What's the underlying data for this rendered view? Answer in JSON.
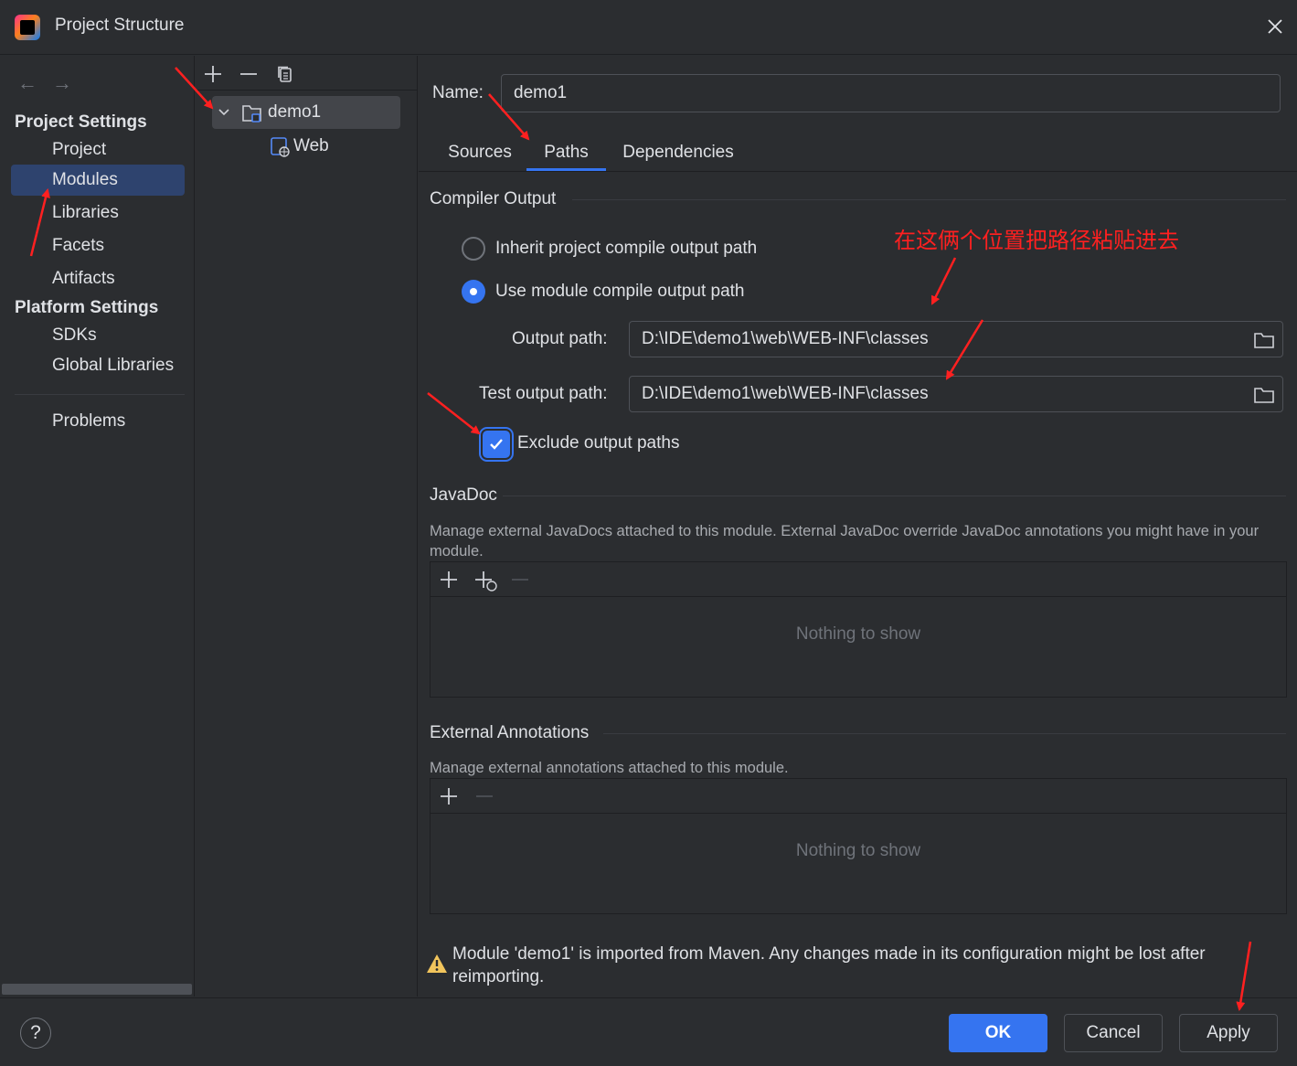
{
  "window": {
    "title": "Project Structure"
  },
  "nav": {
    "back": "←",
    "forward": "→",
    "project_settings_header": "Project Settings",
    "platform_settings_header": "Platform Settings",
    "items": [
      {
        "label": "Project"
      },
      {
        "label": "Modules"
      },
      {
        "label": "Libraries"
      },
      {
        "label": "Facets"
      },
      {
        "label": "Artifacts"
      },
      {
        "label": "SDKs"
      },
      {
        "label": "Global Libraries"
      },
      {
        "label": "Problems"
      }
    ],
    "selected": "Modules"
  },
  "tree": {
    "toolbar": [
      "add-icon",
      "remove-icon",
      "copy-icon"
    ],
    "nodes": [
      {
        "label": "demo1",
        "icon": "module-folder-icon",
        "expanded": true,
        "selected": true
      },
      {
        "label": "Web",
        "icon": "web-facet-icon"
      }
    ]
  },
  "module": {
    "name_label": "Name:",
    "name_value": "demo1",
    "tabs": [
      "Sources",
      "Paths",
      "Dependencies"
    ],
    "active_tab": "Paths",
    "compiler_output": {
      "title": "Compiler Output",
      "inherit_label": "Inherit project compile output path",
      "use_module_label": "Use module compile output path",
      "selected": "use_module",
      "output_path_label": "Output path:",
      "output_path_value": "D:\\IDE\\demo1\\web\\WEB-INF\\classes",
      "test_output_path_label": "Test output path:",
      "test_output_path_value": "D:\\IDE\\demo1\\web\\WEB-INF\\classes",
      "exclude_label": "Exclude output paths",
      "exclude_checked": true
    },
    "javadoc": {
      "title": "JavaDoc",
      "description": "Manage external JavaDocs attached to this module. External JavaDoc override JavaDoc annotations you might have in your module.",
      "empty_text": "Nothing to show"
    },
    "external_annotations": {
      "title": "External Annotations",
      "description": "Manage external annotations attached to this module.",
      "empty_text": "Nothing to show"
    },
    "warning": "Module 'demo1' is imported from Maven. Any changes made in its configuration might be lost after reimporting."
  },
  "buttons": {
    "help": "?",
    "ok": "OK",
    "cancel": "Cancel",
    "apply": "Apply"
  },
  "annotation": {
    "text": "在这俩个位置把路径粘贴进去",
    "color": "#ff2020"
  },
  "colors": {
    "accent": "#3574f0",
    "background": "#2b2d30",
    "selection": "#2e436e"
  }
}
